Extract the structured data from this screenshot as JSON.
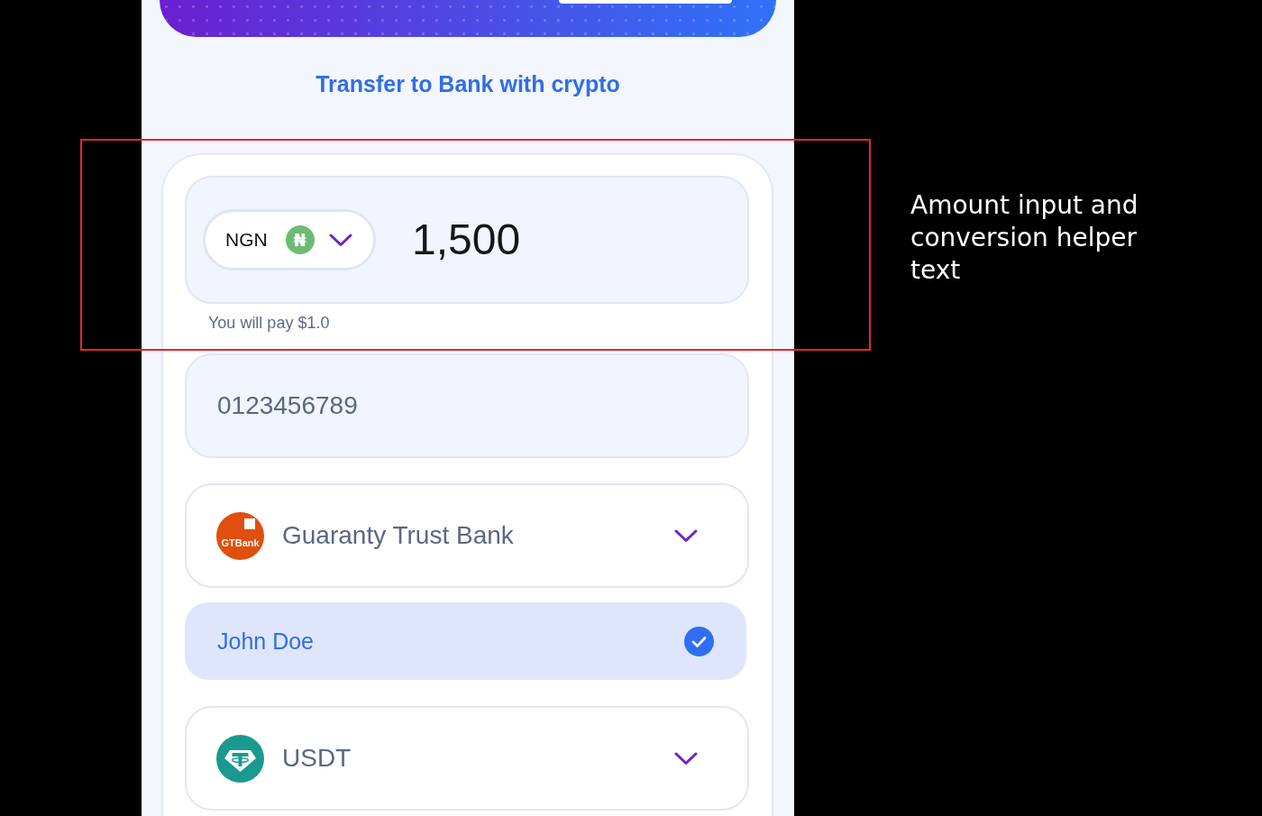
{
  "title": "Transfer to Bank with crypto",
  "amount": {
    "currency": {
      "code": "NGN",
      "symbol": "₦"
    },
    "value": "1,500",
    "helper": "You will pay $1.0"
  },
  "account_number": {
    "value": "0123456789"
  },
  "bank": {
    "logo_text": "GTBank",
    "name": "Guaranty Trust Bank"
  },
  "account_name": {
    "value": "John Doe",
    "verified": true
  },
  "crypto": {
    "name": "USDT"
  },
  "annotation": {
    "text": "Amount input and conversion helper text"
  }
}
